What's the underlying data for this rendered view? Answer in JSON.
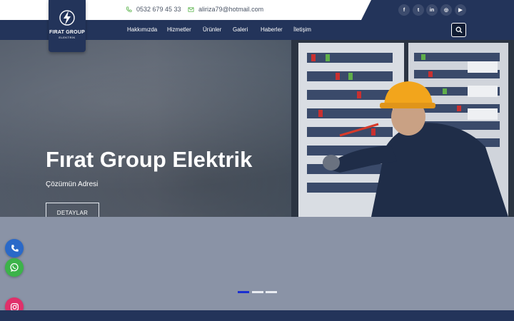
{
  "topbar": {
    "phone": "0532 679 45 33",
    "email": "aliriza79@hotmail.com",
    "social": [
      {
        "name": "facebook-icon",
        "glyph": "f"
      },
      {
        "name": "twitter-icon",
        "glyph": "t"
      },
      {
        "name": "linkedin-icon",
        "glyph": "in"
      },
      {
        "name": "instagram-icon",
        "glyph": "◎"
      },
      {
        "name": "youtube-icon",
        "glyph": "▶"
      }
    ]
  },
  "logo": {
    "title": "FIRAT GROUP",
    "subtitle": "ELEKTRİK"
  },
  "nav": {
    "items": [
      "Hakkımızda",
      "Hizmetler",
      "Ürünler",
      "Galeri",
      "Haberler",
      "İletişim"
    ]
  },
  "hero": {
    "title": "Fırat Group Elektrik",
    "subtitle": "Çözümün Adresi",
    "button": "DETAYLAR"
  },
  "slider": {
    "count": 3,
    "active": 1
  },
  "floating": [
    {
      "name": "phone-float-button",
      "icon": "phone-icon",
      "color": "#2a69c8"
    },
    {
      "name": "whatsapp-float-button",
      "icon": "whatsapp-icon",
      "color": "#3cb34a"
    },
    {
      "name": "instagram-float-button",
      "icon": "instagram-icon",
      "color": "#e0306a"
    }
  ],
  "colors": {
    "navy": "#23345a",
    "accent_blue": "#1b2fd1",
    "helmet": "#f2a51c"
  }
}
